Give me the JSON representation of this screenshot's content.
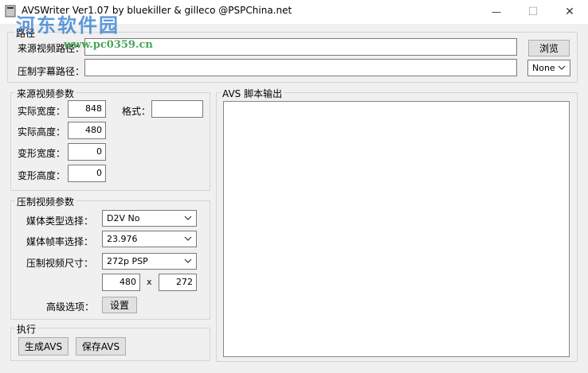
{
  "window": {
    "title": "AVSWriter Ver1.07 by bluekiller & gilleco @PSPChina.net",
    "minimize_glyph": "—",
    "maximize_glyph": "☐",
    "close_glyph": "✕",
    "icons": {
      "app": "app-icon",
      "minimize": "minimize-icon",
      "maximize": "maximize-icon",
      "close": "close-icon"
    }
  },
  "watermark": {
    "text": "河东软件园",
    "url": "www.pc0359.cn"
  },
  "path_group": {
    "title": "路径",
    "source_label": "来源视频路径：",
    "source_value": "",
    "browse_label": "浏览",
    "subtitle_label": "压制字幕路径：",
    "subtitle_value": "",
    "subtitle_option": "None"
  },
  "source_group": {
    "title": "来源视频参数",
    "width_label": "实际宽度：",
    "width_value": "848",
    "format_label": "格式：",
    "format_value": "",
    "height_label": "实际高度：",
    "height_value": "480",
    "deform_width_label": "变形宽度：",
    "deform_width_value": "0",
    "deform_height_label": "变形高度：",
    "deform_height_value": "0"
  },
  "encode_group": {
    "title": "压制视频参数",
    "media_type_label": "媒体类型选择：",
    "media_type_value": "D2V No",
    "framerate_label": "媒体帧率选择：",
    "framerate_value": "23.976",
    "size_label": "压制视频尺寸：",
    "size_value": "272p PSP",
    "size_width": "480",
    "size_x": "x",
    "size_height": "272",
    "advanced_label": "高级选项：",
    "settings_button": "设置"
  },
  "execute_group": {
    "title": "执行",
    "generate_button": "生成AVS",
    "save_button": "保存AVS"
  },
  "output_group": {
    "title": "AVS 脚本输出",
    "content": ""
  }
}
